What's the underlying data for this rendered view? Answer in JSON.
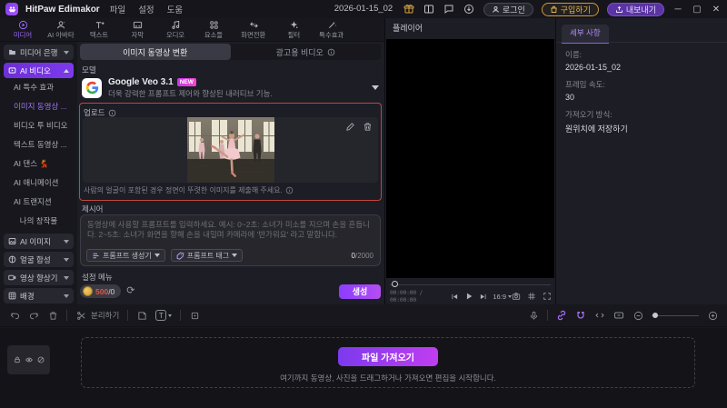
{
  "titlebar": {
    "app_name": "HitPaw Edimakor",
    "menus": [
      "파일",
      "설정",
      "도움"
    ],
    "document_title": "2026-01-15_02",
    "login_label": "로그인",
    "buy_label": "구입하기",
    "export_label": "내보내기"
  },
  "toolbar": {
    "items": [
      {
        "label": "미디어"
      },
      {
        "label": "AI 아바타"
      },
      {
        "label": "텍스트"
      },
      {
        "label": "자막"
      },
      {
        "label": "오디오"
      },
      {
        "label": "요소들"
      },
      {
        "label": "화면전환"
      },
      {
        "label": "필터"
      },
      {
        "label": "특수효과"
      }
    ]
  },
  "sidebar": {
    "media_bank_label": "미디어 은행",
    "ai_video_label": "AI 비디오",
    "ai_video_items": [
      "AI 특수 효과",
      "이미지 동영상 ...",
      "비디오 투 비디오",
      "텍스트 동영상 ...",
      "AI 댄스 💃",
      "AI 애니메이션",
      "AI 트랜지션",
      "나의 창작물"
    ],
    "groups": [
      "AI 이미지",
      "얼굴 합성",
      "영상 향상기",
      "배경"
    ]
  },
  "main": {
    "tab_image_to_video": "이미지 동영상 변환",
    "tab_ad_video": "광고용 비디오",
    "model_section_label": "모델",
    "model_name": "Google Veo 3.1",
    "model_badge": "NEW",
    "model_description": "더욱 강력한 프롬프트 제어와 향상된 내러티브 기능.",
    "upload_section_label": "업로드",
    "upload_notice": "사람의 얼굴이 포함된 경우 정면이 뚜렷한 이미지를 제출해 주세요.",
    "prompt_section_label": "제시어",
    "prompt_placeholder": "동영상에 사용할 프롬프트를 입력하세요. 예시: 0~2초: 소녀가 미소를 지으며 손을 흔듭니다. 2~5초: 소녀가 화면을 향해 손을 내밀며 카메라에 '반가워요' 라고 말합니다.",
    "prompt_generator_label": "프롬프트 생성기",
    "prompt_tag_label": "프롬프트 태그",
    "char_count": "0",
    "char_limit": "/2000",
    "settings_section_label": "설정 메뉴",
    "credits_value": "500",
    "credits_suffix": "/0",
    "generate_label": "생성"
  },
  "player": {
    "title": "플레이어",
    "timecode": "00:00:00 / 00:00:00",
    "aspect_ratio": "16:9"
  },
  "details": {
    "tab_label": "세부 사항",
    "name_label": "이름:",
    "name_value": "2026-01-15_02",
    "fps_label": "프레임 속도:",
    "fps_value": "30",
    "import_mode_label": "가져오기 방식:",
    "import_mode_value": "원위치에 저장하기"
  },
  "timeline": {
    "split_label": "분리하기",
    "text_tool_glyph": "T",
    "import_button_label": "파일 가져오기",
    "drop_hint": "여기까지 동영상, 사진을 드래그하거나 가져오면 편집을 시작합니다."
  },
  "colors": {
    "accent_purple": "#8b5cf6",
    "gold": "#d9a440",
    "upload_alert_border": "#c0473a",
    "new_badge": "#d93df0"
  }
}
